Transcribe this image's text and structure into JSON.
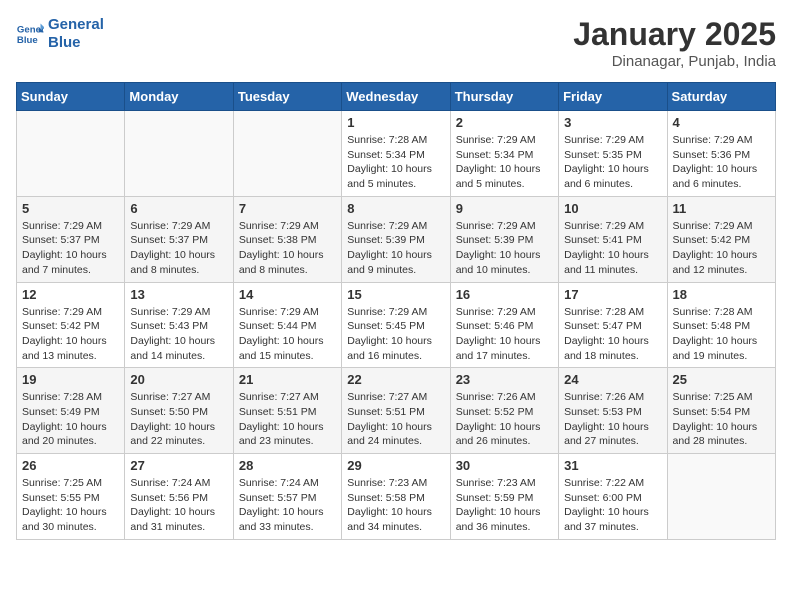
{
  "header": {
    "logo_line1": "General",
    "logo_line2": "Blue",
    "month_title": "January 2025",
    "location": "Dinanagar, Punjab, India"
  },
  "weekdays": [
    "Sunday",
    "Monday",
    "Tuesday",
    "Wednesday",
    "Thursday",
    "Friday",
    "Saturday"
  ],
  "weeks": [
    [
      {
        "day": "",
        "sunrise": "",
        "sunset": "",
        "daylight": ""
      },
      {
        "day": "",
        "sunrise": "",
        "sunset": "",
        "daylight": ""
      },
      {
        "day": "",
        "sunrise": "",
        "sunset": "",
        "daylight": ""
      },
      {
        "day": "1",
        "sunrise": "Sunrise: 7:28 AM",
        "sunset": "Sunset: 5:34 PM",
        "daylight": "Daylight: 10 hours and 5 minutes."
      },
      {
        "day": "2",
        "sunrise": "Sunrise: 7:29 AM",
        "sunset": "Sunset: 5:34 PM",
        "daylight": "Daylight: 10 hours and 5 minutes."
      },
      {
        "day": "3",
        "sunrise": "Sunrise: 7:29 AM",
        "sunset": "Sunset: 5:35 PM",
        "daylight": "Daylight: 10 hours and 6 minutes."
      },
      {
        "day": "4",
        "sunrise": "Sunrise: 7:29 AM",
        "sunset": "Sunset: 5:36 PM",
        "daylight": "Daylight: 10 hours and 6 minutes."
      }
    ],
    [
      {
        "day": "5",
        "sunrise": "Sunrise: 7:29 AM",
        "sunset": "Sunset: 5:37 PM",
        "daylight": "Daylight: 10 hours and 7 minutes."
      },
      {
        "day": "6",
        "sunrise": "Sunrise: 7:29 AM",
        "sunset": "Sunset: 5:37 PM",
        "daylight": "Daylight: 10 hours and 8 minutes."
      },
      {
        "day": "7",
        "sunrise": "Sunrise: 7:29 AM",
        "sunset": "Sunset: 5:38 PM",
        "daylight": "Daylight: 10 hours and 8 minutes."
      },
      {
        "day": "8",
        "sunrise": "Sunrise: 7:29 AM",
        "sunset": "Sunset: 5:39 PM",
        "daylight": "Daylight: 10 hours and 9 minutes."
      },
      {
        "day": "9",
        "sunrise": "Sunrise: 7:29 AM",
        "sunset": "Sunset: 5:39 PM",
        "daylight": "Daylight: 10 hours and 10 minutes."
      },
      {
        "day": "10",
        "sunrise": "Sunrise: 7:29 AM",
        "sunset": "Sunset: 5:41 PM",
        "daylight": "Daylight: 10 hours and 11 minutes."
      },
      {
        "day": "11",
        "sunrise": "Sunrise: 7:29 AM",
        "sunset": "Sunset: 5:42 PM",
        "daylight": "Daylight: 10 hours and 12 minutes."
      }
    ],
    [
      {
        "day": "12",
        "sunrise": "Sunrise: 7:29 AM",
        "sunset": "Sunset: 5:42 PM",
        "daylight": "Daylight: 10 hours and 13 minutes."
      },
      {
        "day": "13",
        "sunrise": "Sunrise: 7:29 AM",
        "sunset": "Sunset: 5:43 PM",
        "daylight": "Daylight: 10 hours and 14 minutes."
      },
      {
        "day": "14",
        "sunrise": "Sunrise: 7:29 AM",
        "sunset": "Sunset: 5:44 PM",
        "daylight": "Daylight: 10 hours and 15 minutes."
      },
      {
        "day": "15",
        "sunrise": "Sunrise: 7:29 AM",
        "sunset": "Sunset: 5:45 PM",
        "daylight": "Daylight: 10 hours and 16 minutes."
      },
      {
        "day": "16",
        "sunrise": "Sunrise: 7:29 AM",
        "sunset": "Sunset: 5:46 PM",
        "daylight": "Daylight: 10 hours and 17 minutes."
      },
      {
        "day": "17",
        "sunrise": "Sunrise: 7:28 AM",
        "sunset": "Sunset: 5:47 PM",
        "daylight": "Daylight: 10 hours and 18 minutes."
      },
      {
        "day": "18",
        "sunrise": "Sunrise: 7:28 AM",
        "sunset": "Sunset: 5:48 PM",
        "daylight": "Daylight: 10 hours and 19 minutes."
      }
    ],
    [
      {
        "day": "19",
        "sunrise": "Sunrise: 7:28 AM",
        "sunset": "Sunset: 5:49 PM",
        "daylight": "Daylight: 10 hours and 20 minutes."
      },
      {
        "day": "20",
        "sunrise": "Sunrise: 7:27 AM",
        "sunset": "Sunset: 5:50 PM",
        "daylight": "Daylight: 10 hours and 22 minutes."
      },
      {
        "day": "21",
        "sunrise": "Sunrise: 7:27 AM",
        "sunset": "Sunset: 5:51 PM",
        "daylight": "Daylight: 10 hours and 23 minutes."
      },
      {
        "day": "22",
        "sunrise": "Sunrise: 7:27 AM",
        "sunset": "Sunset: 5:51 PM",
        "daylight": "Daylight: 10 hours and 24 minutes."
      },
      {
        "day": "23",
        "sunrise": "Sunrise: 7:26 AM",
        "sunset": "Sunset: 5:52 PM",
        "daylight": "Daylight: 10 hours and 26 minutes."
      },
      {
        "day": "24",
        "sunrise": "Sunrise: 7:26 AM",
        "sunset": "Sunset: 5:53 PM",
        "daylight": "Daylight: 10 hours and 27 minutes."
      },
      {
        "day": "25",
        "sunrise": "Sunrise: 7:25 AM",
        "sunset": "Sunset: 5:54 PM",
        "daylight": "Daylight: 10 hours and 28 minutes."
      }
    ],
    [
      {
        "day": "26",
        "sunrise": "Sunrise: 7:25 AM",
        "sunset": "Sunset: 5:55 PM",
        "daylight": "Daylight: 10 hours and 30 minutes."
      },
      {
        "day": "27",
        "sunrise": "Sunrise: 7:24 AM",
        "sunset": "Sunset: 5:56 PM",
        "daylight": "Daylight: 10 hours and 31 minutes."
      },
      {
        "day": "28",
        "sunrise": "Sunrise: 7:24 AM",
        "sunset": "Sunset: 5:57 PM",
        "daylight": "Daylight: 10 hours and 33 minutes."
      },
      {
        "day": "29",
        "sunrise": "Sunrise: 7:23 AM",
        "sunset": "Sunset: 5:58 PM",
        "daylight": "Daylight: 10 hours and 34 minutes."
      },
      {
        "day": "30",
        "sunrise": "Sunrise: 7:23 AM",
        "sunset": "Sunset: 5:59 PM",
        "daylight": "Daylight: 10 hours and 36 minutes."
      },
      {
        "day": "31",
        "sunrise": "Sunrise: 7:22 AM",
        "sunset": "Sunset: 6:00 PM",
        "daylight": "Daylight: 10 hours and 37 minutes."
      },
      {
        "day": "",
        "sunrise": "",
        "sunset": "",
        "daylight": ""
      }
    ]
  ]
}
